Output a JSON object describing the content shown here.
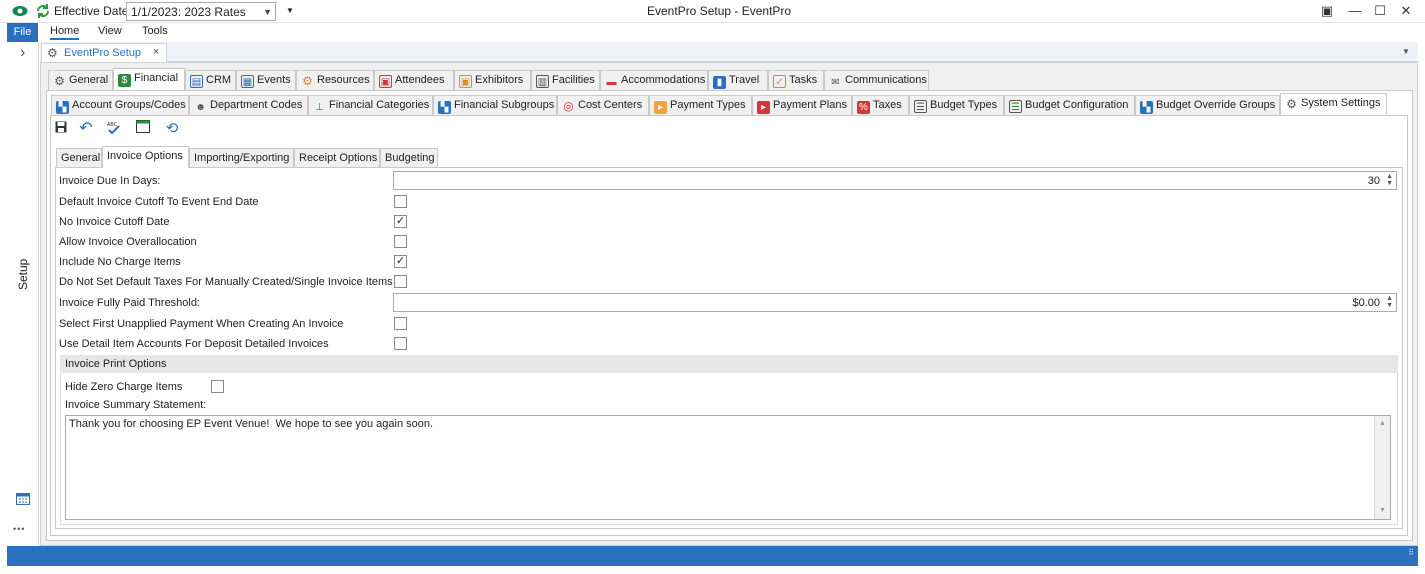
{
  "titlebar": {
    "effective_date_label": "Effective Date",
    "rate_value": "1/1/2023: 2023 Rates",
    "window_title": "EventPro Setup - EventPro",
    "restore_glyph": "▣",
    "minimize_glyph": "—",
    "maximize_glyph": "☐",
    "close_glyph": "✕"
  },
  "ribbon": {
    "file": "File",
    "menus": [
      "Home",
      "View",
      "Tools"
    ]
  },
  "leftnav": {
    "label": "Setup",
    "expand_glyph": "›",
    "more_glyph": "•••"
  },
  "doc_tab": {
    "label": "EventPro Setup",
    "close_glyph": "×"
  },
  "main_tabs": [
    {
      "label": "General",
      "icon": "gear-icon"
    },
    {
      "label": "Financial",
      "icon": "dollar-icon"
    },
    {
      "label": "CRM",
      "icon": "contact-card-icon"
    },
    {
      "label": "Events",
      "icon": "calendar-icon"
    },
    {
      "label": "Resources",
      "icon": "gear-orange-icon"
    },
    {
      "label": "Attendees",
      "icon": "attendees-icon"
    },
    {
      "label": "Exhibitors",
      "icon": "exhibitor-icon"
    },
    {
      "label": "Facilities",
      "icon": "building-icon"
    },
    {
      "label": "Accommodations",
      "icon": "bed-icon"
    },
    {
      "label": "Travel",
      "icon": "suitcase-icon"
    },
    {
      "label": "Tasks",
      "icon": "clipboard-icon"
    },
    {
      "label": "Communications",
      "icon": "envelope-icon"
    }
  ],
  "sub_tabs": [
    {
      "label": "Account Groups/Codes",
      "icon": "account-groups-icon"
    },
    {
      "label": "Department Codes",
      "icon": "people-icon"
    },
    {
      "label": "Financial Categories",
      "icon": "hierarchy-icon"
    },
    {
      "label": "Financial Subgroups",
      "icon": "subgroups-icon"
    },
    {
      "label": "Cost Centers",
      "icon": "target-icon"
    },
    {
      "label": "Payment Types",
      "icon": "payment-tag-icon"
    },
    {
      "label": "Payment Plans",
      "icon": "payment-plan-icon"
    },
    {
      "label": "Taxes",
      "icon": "tax-icon"
    },
    {
      "label": "Budget Types",
      "icon": "budget-types-icon"
    },
    {
      "label": "Budget Configuration",
      "icon": "budget-config-icon"
    },
    {
      "label": "Budget Override Groups",
      "icon": "override-icon"
    },
    {
      "label": "System Settings",
      "icon": "gear-icon"
    }
  ],
  "inner_tabs": [
    "General",
    "Invoice Options",
    "Importing/Exporting",
    "Receipt Options",
    "Budgeting"
  ],
  "fields": {
    "invoice_due_label": "Invoice Due In Days:",
    "invoice_due_value": "30",
    "default_cutoff_label": "Default Invoice Cutoff To Event End Date",
    "no_cutoff_label": "No Invoice Cutoff Date",
    "allow_overalloc_label": "Allow Invoice Overallocation",
    "include_no_charge_label": "Include No Charge Items",
    "no_default_taxes_label": "Do Not Set Default Taxes For Manually Created/Single Invoice Items",
    "paid_threshold_label": "Invoice Fully Paid Threshold:",
    "paid_threshold_value": "$0.00",
    "select_first_label": "Select First Unapplied Payment When Creating An Invoice",
    "detail_accounts_label": "Use Detail Item Accounts For Deposit Detailed Invoices"
  },
  "checks": {
    "default_cutoff": false,
    "no_cutoff": true,
    "allow_overalloc": false,
    "include_no_charge": true,
    "no_default_taxes": false,
    "select_first": false,
    "detail_accounts": false,
    "hide_zero": false
  },
  "print_options": {
    "header": "Invoice Print Options",
    "hide_zero_label": "Hide Zero Charge Items",
    "summary_label": "Invoice Summary Statement:",
    "summary_text": "Thank you for choosing EP Event Venue!  We hope to see you again soon."
  },
  "colors": {
    "accent": "#2b6fbf"
  }
}
